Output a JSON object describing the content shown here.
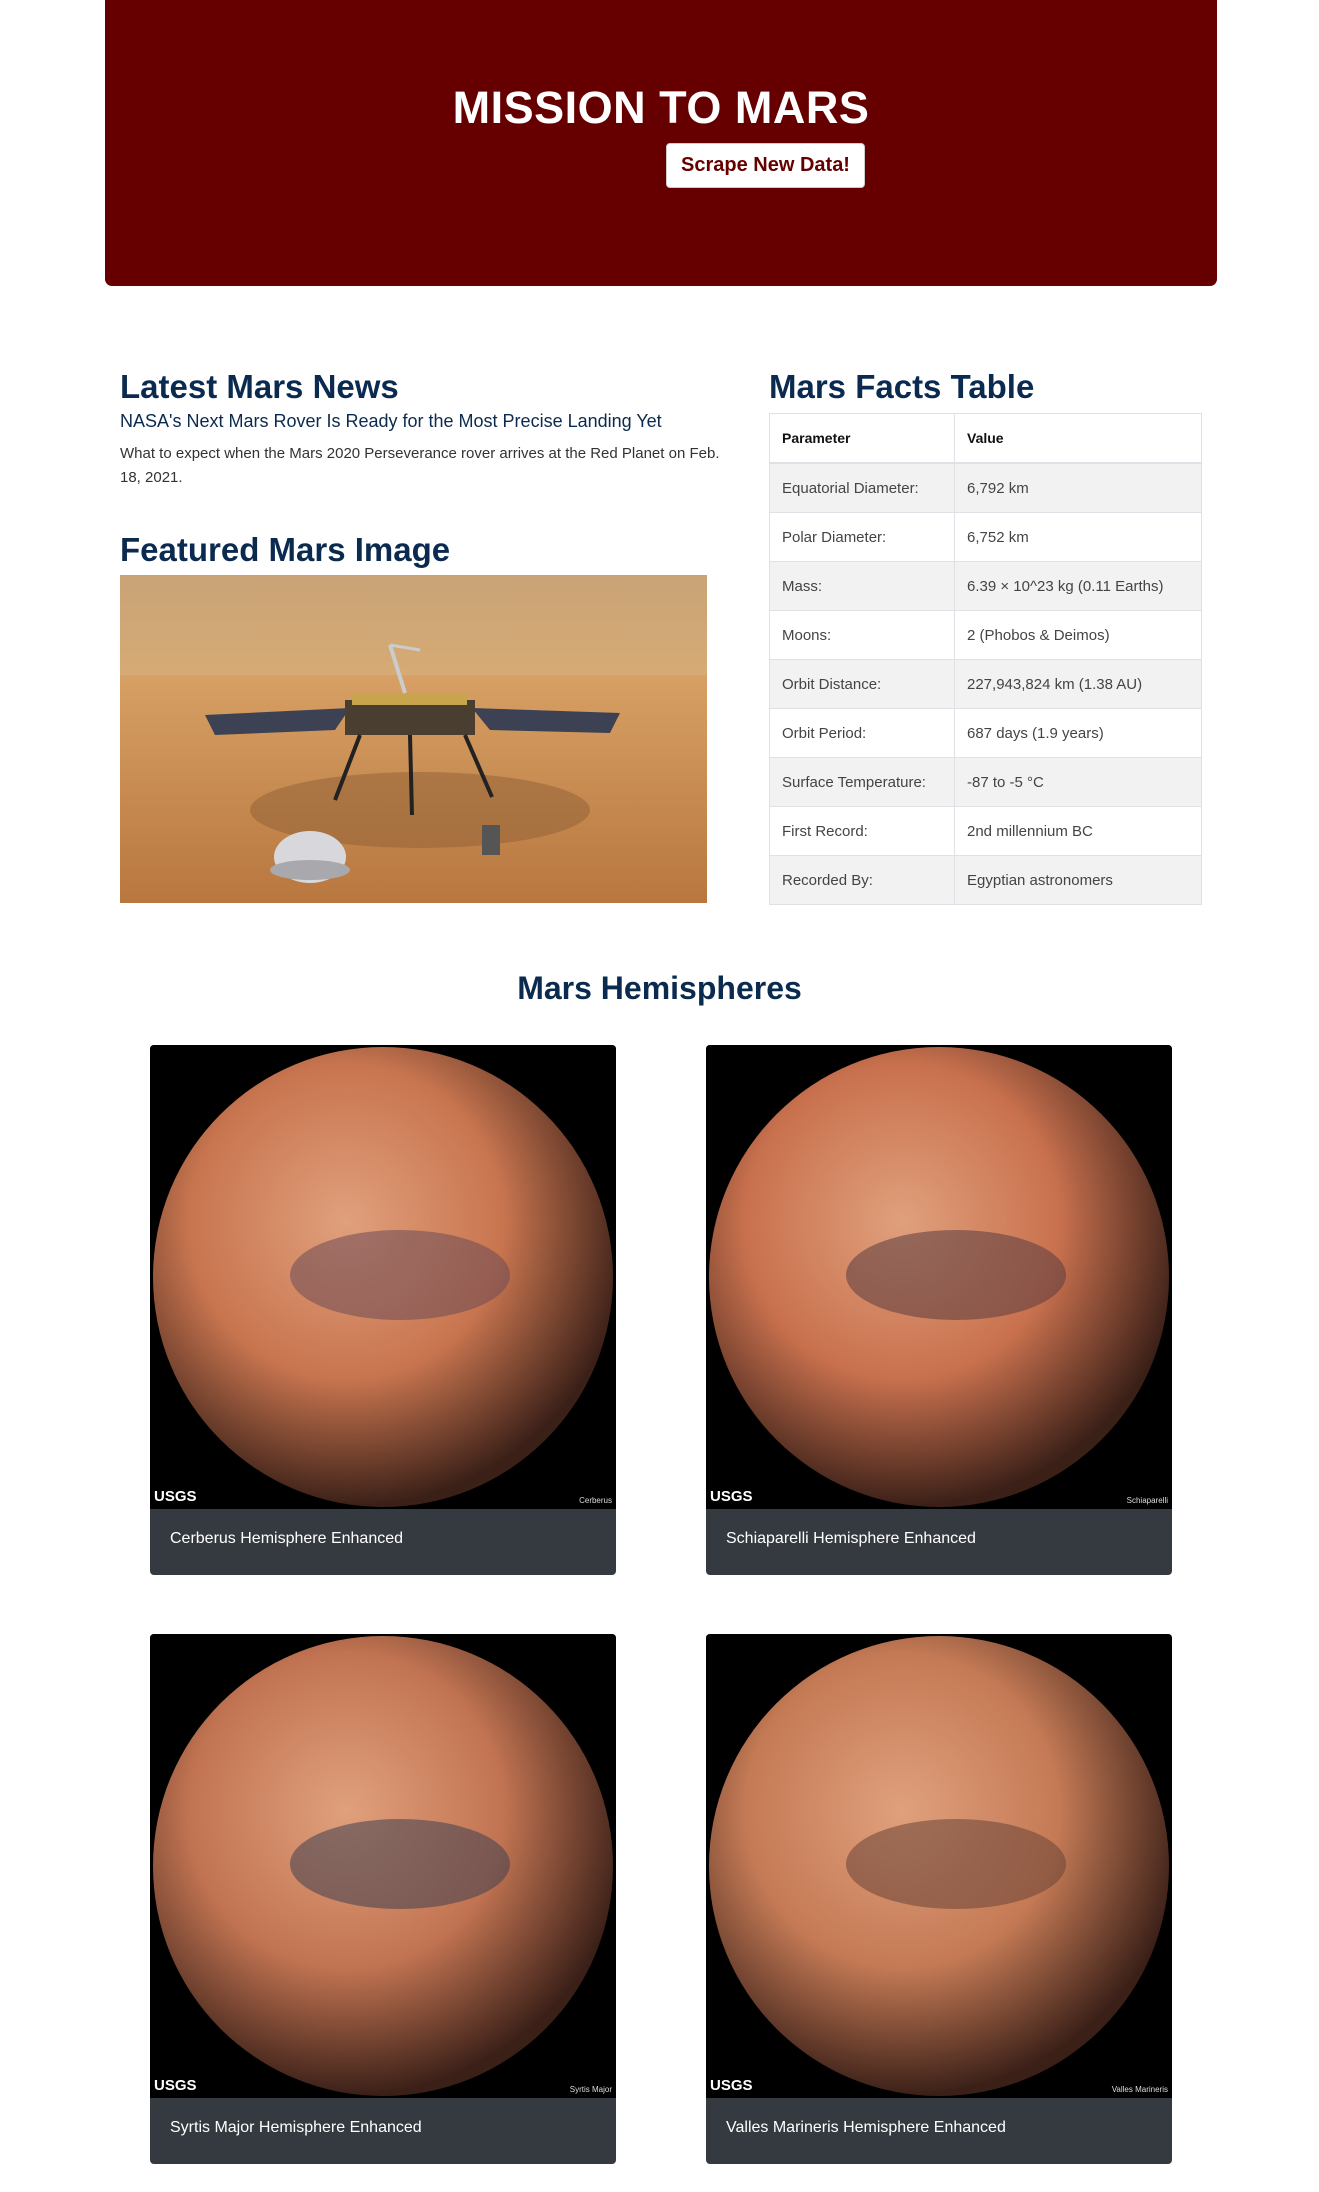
{
  "header": {
    "title": "MISSION TO MARS",
    "button_label": "Scrape New Data!"
  },
  "news": {
    "heading": "Latest Mars News",
    "title": "NASA's Next Mars Rover Is Ready for the Most Precise Landing Yet",
    "teaser": "What to expect when the Mars 2020 Perseverance rover arrives at the Red Planet on Feb. 18, 2021."
  },
  "featured": {
    "heading": "Featured Mars Image"
  },
  "facts": {
    "heading": "Mars Facts Table",
    "columns": [
      "Parameter",
      "Value"
    ],
    "rows": [
      [
        "Equatorial Diameter:",
        "6,792 km"
      ],
      [
        "Polar Diameter:",
        "6,752 km"
      ],
      [
        "Mass:",
        "6.39 × 10^23 kg (0.11 Earths)"
      ],
      [
        "Moons:",
        "2 (Phobos & Deimos)"
      ],
      [
        "Orbit Distance:",
        "227,943,824 km (1.38 AU)"
      ],
      [
        "Orbit Period:",
        "687 days (1.9 years)"
      ],
      [
        "Surface Temperature:",
        "-87 to -5 °C"
      ],
      [
        "First Record:",
        "2nd millennium BC"
      ],
      [
        "Recorded By:",
        "Egyptian astronomers"
      ]
    ]
  },
  "hemispheres": {
    "heading": "Mars Hemispheres",
    "items": [
      {
        "caption": "Cerberus Hemisphere Enhanced",
        "label": "Cerberus",
        "base": "#c8754f",
        "dark": "#6e4a55"
      },
      {
        "caption": "Schiaparelli Hemisphere Enhanced",
        "label": "Schiaparelli",
        "base": "#c9714e",
        "dark": "#5a3c40"
      },
      {
        "caption": "Syrtis Major Hemisphere Enhanced",
        "label": "Syrtis Major",
        "base": "#c27452",
        "dark": "#3f4050"
      },
      {
        "caption": "Valles Marineris Hemisphere Enhanced",
        "label": "Valles Marineris",
        "base": "#c47a55",
        "dark": "#6a4438"
      }
    ],
    "badge": "USGS"
  }
}
